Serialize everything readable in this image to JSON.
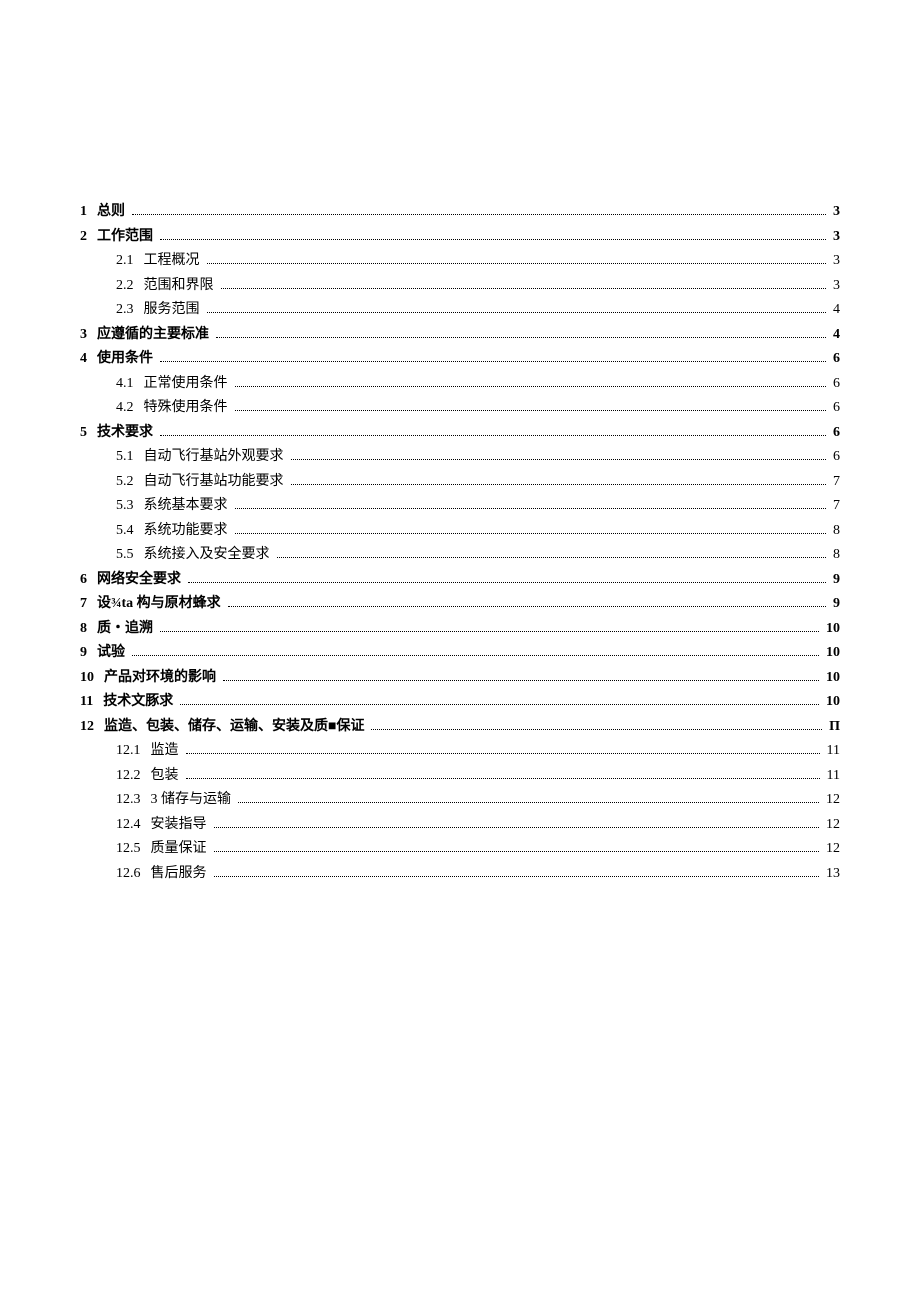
{
  "toc": [
    {
      "level": 0,
      "num": "1",
      "title": "总则",
      "page": "3"
    },
    {
      "level": 0,
      "num": "2",
      "title": "工作范围",
      "page": "3"
    },
    {
      "level": 1,
      "num": "2.1",
      "title": "工程概况",
      "page": "3"
    },
    {
      "level": 1,
      "num": "2.2",
      "title": "范围和界限",
      "page": "3"
    },
    {
      "level": 1,
      "num": "2.3",
      "title": "服务范围",
      "page": "4"
    },
    {
      "level": 0,
      "num": "3",
      "title": "应遵循的主要标准",
      "page": "4"
    },
    {
      "level": 0,
      "num": "4",
      "title": "使用条件",
      "page": "6"
    },
    {
      "level": 1,
      "num": "4.1",
      "title": "正常使用条件",
      "page": "6"
    },
    {
      "level": 1,
      "num": "4.2",
      "title": "特殊使用条件",
      "page": "6"
    },
    {
      "level": 0,
      "num": "5",
      "title": "技术要求",
      "page": "6"
    },
    {
      "level": 1,
      "num": "5.1",
      "title": "自动飞行基站外观要求",
      "page": "6"
    },
    {
      "level": 1,
      "num": "5.2",
      "title": "自动飞行基站功能要求",
      "page": "7"
    },
    {
      "level": 1,
      "num": "5.3",
      "title": "系统基本要求",
      "page": "7"
    },
    {
      "level": 1,
      "num": "5.4",
      "title": "系统功能要求",
      "page": "8"
    },
    {
      "level": 1,
      "num": "5.5",
      "title": "系统接入及安全要求",
      "page": "8"
    },
    {
      "level": 0,
      "num": "6",
      "title": "网络安全要求",
      "page": "9"
    },
    {
      "level": 0,
      "num": "7",
      "title": "设¾ta 构与原材蜂求",
      "page": "9"
    },
    {
      "level": 0,
      "num": "8",
      "title": "质・追溯",
      "page": "10"
    },
    {
      "level": 0,
      "num": "9",
      "title": "试验",
      "page": "10"
    },
    {
      "level": 0,
      "num": "10",
      "title": "产品对环境的影响",
      "page": "10"
    },
    {
      "level": 0,
      "num": "11",
      "title": "技术文豚求",
      "page": "10"
    },
    {
      "level": 0,
      "num": "12",
      "title": "监造、包装、储存、运输、安装及质■保证",
      "page": "Π"
    },
    {
      "level": 1,
      "num": "12.1",
      "title": "监造",
      "page": "11"
    },
    {
      "level": 1,
      "num": "12.2",
      "title": "包装",
      "page": "11"
    },
    {
      "level": 1,
      "num": "12.3",
      "title": "3 储存与运输",
      "page": "12"
    },
    {
      "level": 1,
      "num": "12.4",
      "title": "安装指导",
      "page": "12"
    },
    {
      "level": 1,
      "num": "12.5",
      "title": "质量保证",
      "page": "12"
    },
    {
      "level": 1,
      "num": "12.6",
      "title": "售后服务",
      "page": "13"
    }
  ]
}
